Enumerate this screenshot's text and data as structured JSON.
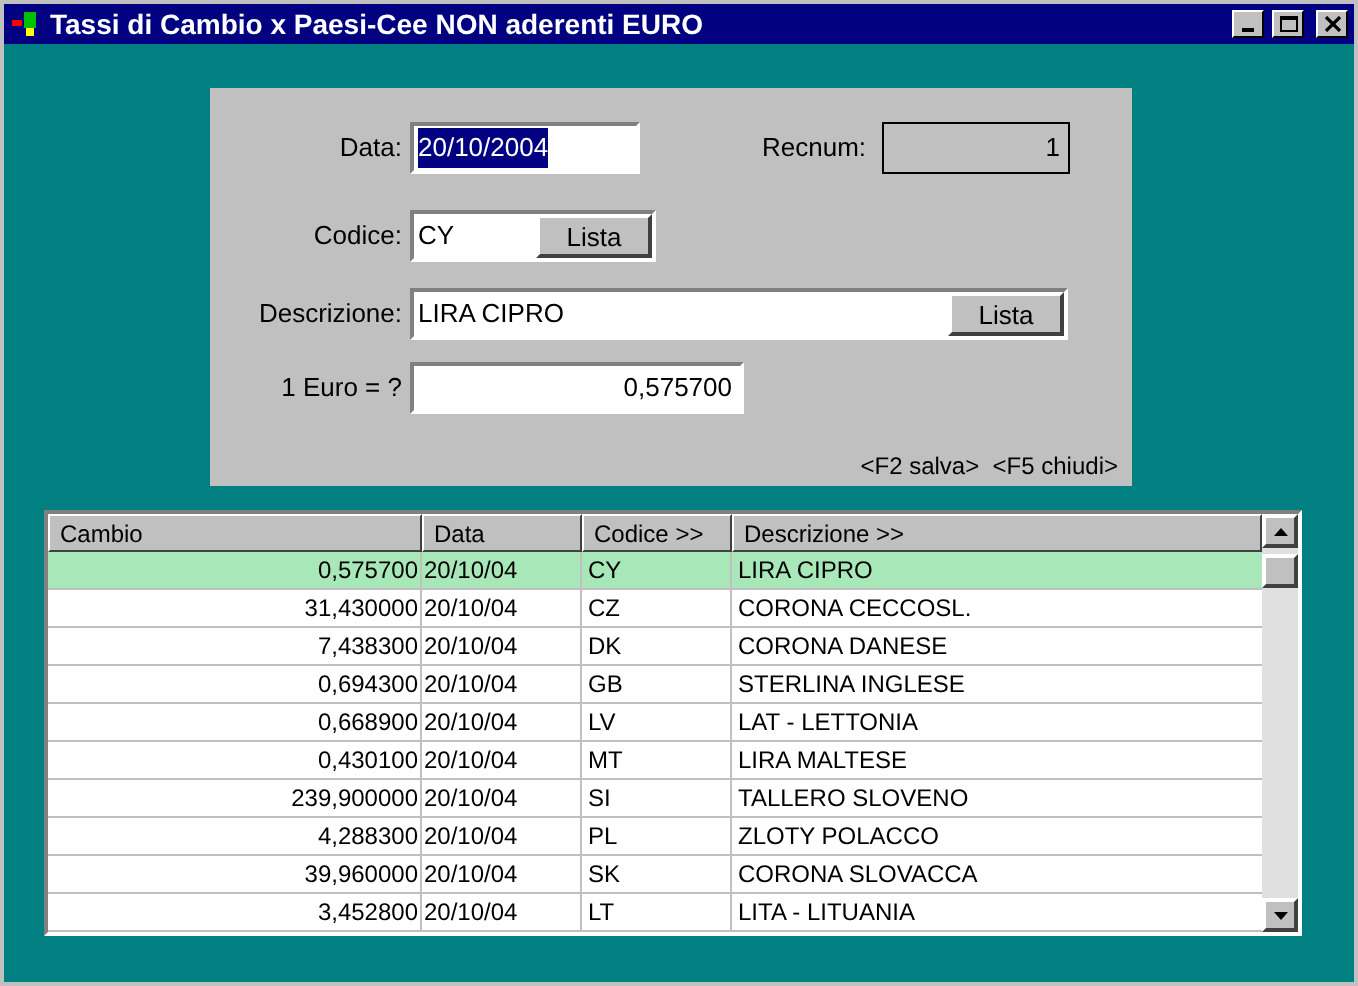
{
  "window": {
    "title": "Tassi di Cambio x Paesi-Cee NON aderenti EURO"
  },
  "form": {
    "data_label": "Data:",
    "data_value": "20/10/2004",
    "recnum_label": "Recnum:",
    "recnum_value": "1",
    "codice_label": "Codice:",
    "codice_value": "CY",
    "codice_button": "Lista",
    "descrizione_label": "Descrizione:",
    "descrizione_value": "LIRA CIPRO",
    "descrizione_button": "Lista",
    "euro_label": "1 Euro = ?",
    "euro_value": "0,575700",
    "shortcuts": "<F2 salva>  <F5 chiudi>"
  },
  "table": {
    "columns": [
      "Cambio",
      "Data",
      "Codice >>",
      "Descrizione >>"
    ],
    "rows": [
      {
        "cambio": "0,575700",
        "data": "20/10/04",
        "codice": "CY",
        "descrizione": "LIRA CIPRO",
        "selected": true
      },
      {
        "cambio": "31,430000",
        "data": "20/10/04",
        "codice": "CZ",
        "descrizione": "CORONA CECCOSL.",
        "selected": false
      },
      {
        "cambio": "7,438300",
        "data": "20/10/04",
        "codice": "DK",
        "descrizione": "CORONA DANESE",
        "selected": false
      },
      {
        "cambio": "0,694300",
        "data": "20/10/04",
        "codice": "GB",
        "descrizione": "STERLINA INGLESE",
        "selected": false
      },
      {
        "cambio": "0,668900",
        "data": "20/10/04",
        "codice": "LV",
        "descrizione": "LAT - LETTONIA",
        "selected": false
      },
      {
        "cambio": "0,430100",
        "data": "20/10/04",
        "codice": "MT",
        "descrizione": "LIRA MALTESE",
        "selected": false
      },
      {
        "cambio": "239,900000",
        "data": "20/10/04",
        "codice": "SI",
        "descrizione": "TALLERO SLOVENO",
        "selected": false
      },
      {
        "cambio": "4,288300",
        "data": "20/10/04",
        "codice": "PL",
        "descrizione": "ZLOTY POLACCO",
        "selected": false
      },
      {
        "cambio": "39,960000",
        "data": "20/10/04",
        "codice": "SK",
        "descrizione": "CORONA SLOVACCA",
        "selected": false
      },
      {
        "cambio": "3,452800",
        "data": "20/10/04",
        "codice": "LT",
        "descrizione": "LITA - LITUANIA",
        "selected": false
      }
    ]
  }
}
